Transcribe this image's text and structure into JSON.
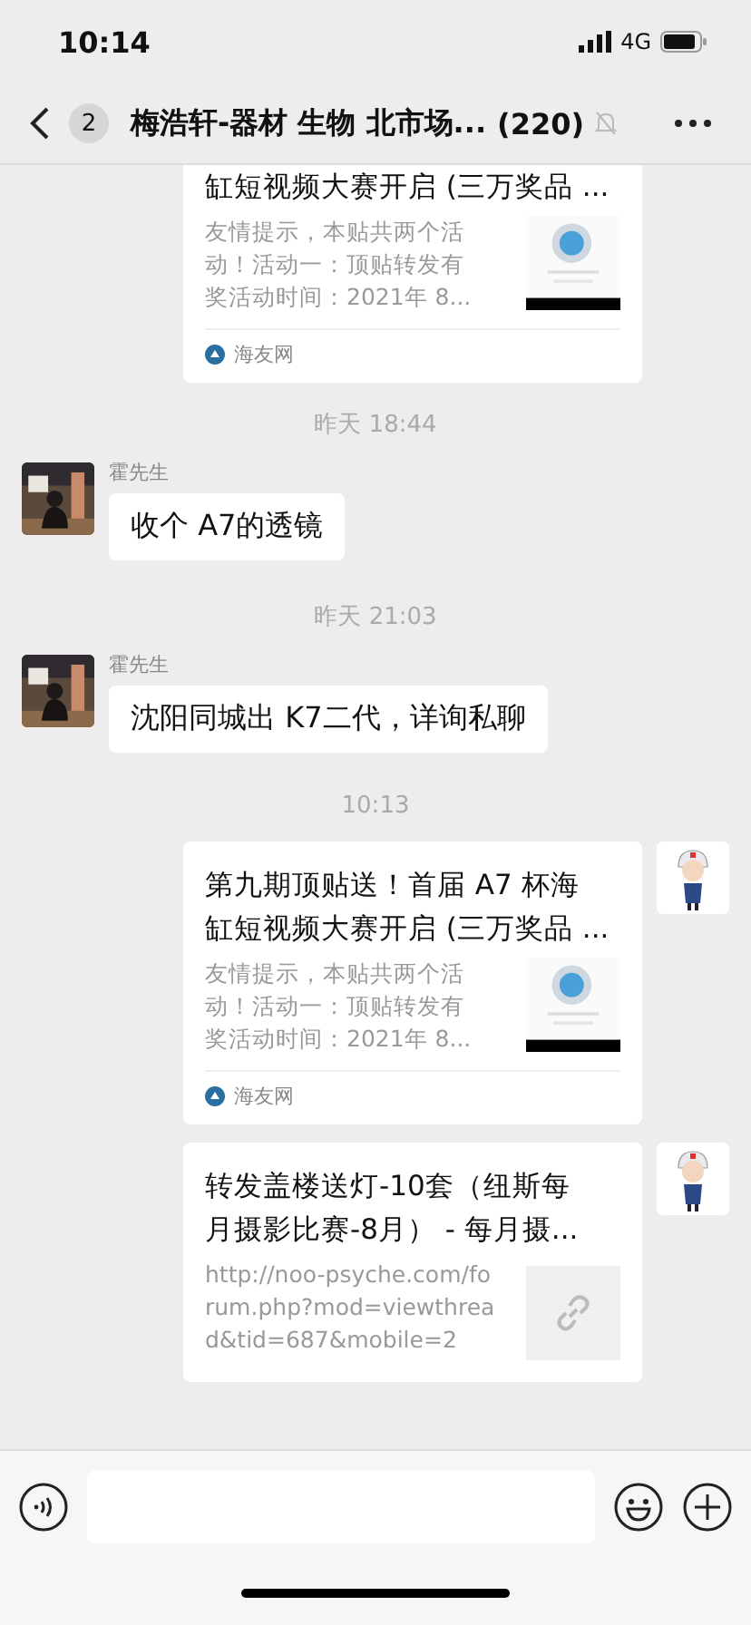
{
  "status_bar": {
    "time": "10:14",
    "network": "4G"
  },
  "header": {
    "back_badge": "2",
    "title": "梅浩轩-器材 生物 北市场...",
    "member_count": "(220)",
    "muted": true
  },
  "messages": [
    {
      "kind": "article",
      "cut_top": true,
      "title_lines": [
        "缸短视频大赛开启 (三万奖品 ..."
      ],
      "desc_lines": [
        "友情提示，本贴共两个活",
        "动！活动一：顶贴转发有",
        "奖活动时间：2021年 8..."
      ],
      "source": "海友网"
    },
    {
      "kind": "time",
      "text": "昨天 18:44"
    },
    {
      "kind": "incoming",
      "sender": "霍先生",
      "text": "收个 A7的透镜"
    },
    {
      "kind": "time",
      "text": "昨天 21:03"
    },
    {
      "kind": "incoming",
      "sender": "霍先生",
      "text": "沈阳同城出 K7二代，详询私聊"
    },
    {
      "kind": "time",
      "text": "10:13"
    },
    {
      "kind": "article",
      "cut_top": false,
      "title_lines": [
        "第九期顶贴送！首届 A7 杯海",
        "缸短视频大赛开启 (三万奖品 ..."
      ],
      "desc_lines": [
        "友情提示，本贴共两个活",
        "动！活动一：顶贴转发有",
        "奖活动时间：2021年 8..."
      ],
      "source": "海友网"
    },
    {
      "kind": "link",
      "cut_top": false,
      "title_lines": [
        "转发盖楼送灯-10套（纽斯每",
        "月摄影比赛-8月） - 每月摄..."
      ],
      "desc_lines": [
        "http://noo-psyche.com/fo",
        "rum.php?mod=viewthrea",
        "d&tid=687&mobile=2"
      ]
    }
  ]
}
